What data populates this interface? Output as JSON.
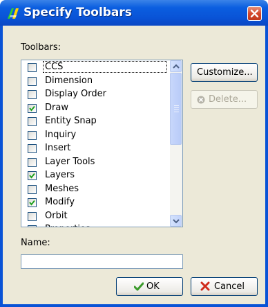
{
  "window": {
    "title": "Specify Toolbars"
  },
  "labels": {
    "toolbars": "Toolbars:",
    "name": "Name:"
  },
  "toolbars": [
    {
      "label": "CCS",
      "checked": false
    },
    {
      "label": "Dimension",
      "checked": false
    },
    {
      "label": "Display Order",
      "checked": false
    },
    {
      "label": "Draw",
      "checked": true
    },
    {
      "label": "Entity Snap",
      "checked": false
    },
    {
      "label": "Inquiry",
      "checked": false
    },
    {
      "label": "Insert",
      "checked": false
    },
    {
      "label": "Layer Tools",
      "checked": false
    },
    {
      "label": "Layers",
      "checked": true
    },
    {
      "label": "Meshes",
      "checked": false
    },
    {
      "label": "Modify",
      "checked": true
    },
    {
      "label": "Orbit",
      "checked": false
    },
    {
      "label": "Properties",
      "checked": true
    }
  ],
  "buttons": {
    "customize": "Customize...",
    "delete": "Delete...",
    "ok": "OK",
    "cancel": "Cancel"
  },
  "name_field": {
    "value": ""
  },
  "colors": {
    "title_bar": "#0953d6",
    "dialog_bg": "#ece9d8",
    "ok_check": "#3a9a2a",
    "cancel_x": "#d02a1a"
  }
}
